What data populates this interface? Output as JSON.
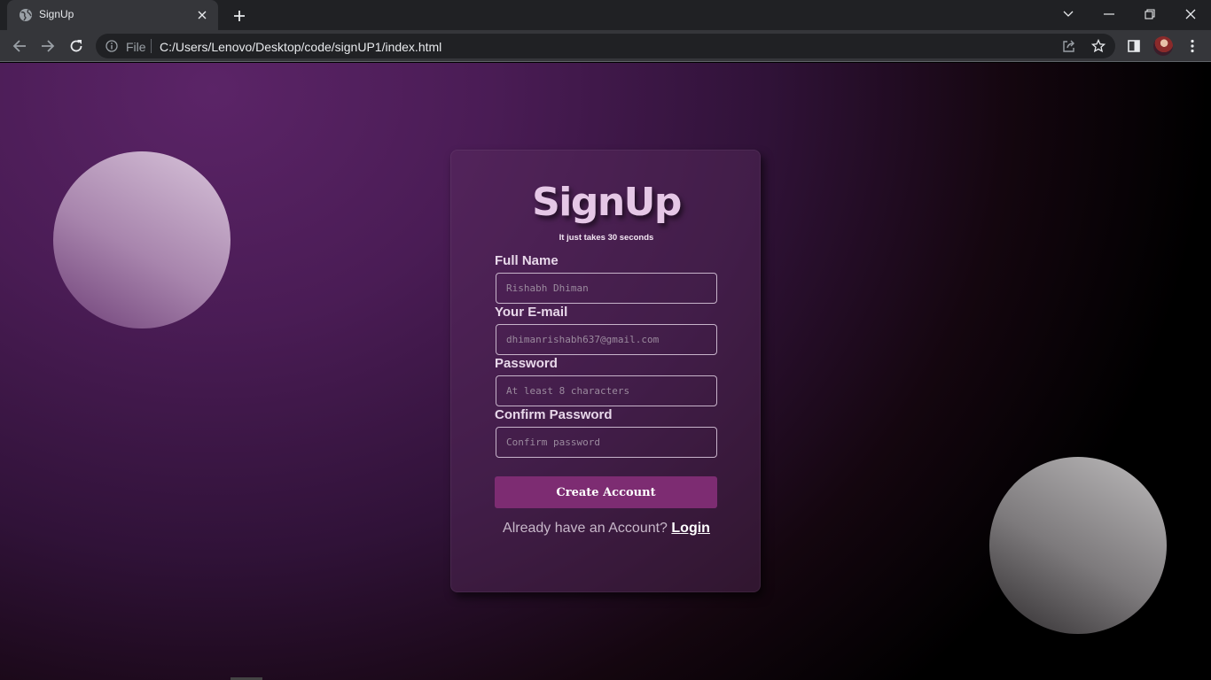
{
  "browser": {
    "tab_title": "SignUp",
    "omnibox_scheme": "File",
    "url": "C:/Users/Lenovo/Desktop/code/signUP1/index.html"
  },
  "form": {
    "title": "SignUp",
    "subtitle": "It just takes 30 seconds",
    "fields": [
      {
        "label": "Full Name",
        "placeholder": "Rishabh Dhiman",
        "value": ""
      },
      {
        "label": "Your E-mail",
        "placeholder": "dhimanrishabh637@gmail.com",
        "value": ""
      },
      {
        "label": "Password",
        "placeholder": "At least 8 characters",
        "value": ""
      },
      {
        "label": "Confirm Password",
        "placeholder": "Confirm password",
        "value": ""
      }
    ],
    "submit_label": "Create Account",
    "login_prompt": "Already have an Account?",
    "login_link": "Login"
  },
  "colors": {
    "accent": "#7d2c72",
    "title": "#e5c7e6",
    "background_start": "#5b2467",
    "background_end": "#000000"
  },
  "icons": [
    "globe-icon",
    "close-icon",
    "plus-icon",
    "chevron-down-icon",
    "minimize-icon",
    "restore-icon",
    "back-icon",
    "forward-icon",
    "reload-icon",
    "info-icon",
    "share-icon",
    "star-icon",
    "side-panel-icon",
    "kebab-menu-icon"
  ]
}
